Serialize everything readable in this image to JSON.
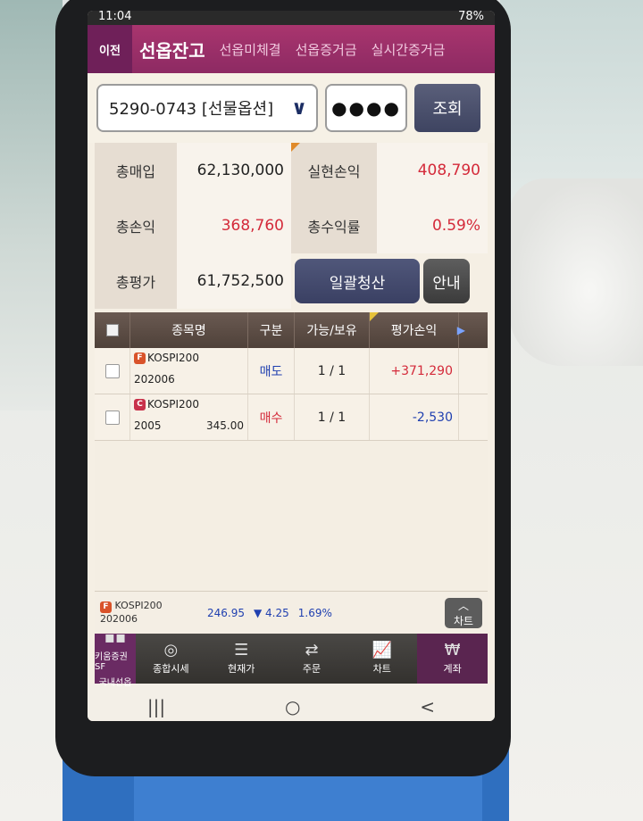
{
  "status_bar": {
    "time": "11:04",
    "battery": "78%"
  },
  "tabs": {
    "prev_label": "이전",
    "items": [
      "선옵잔고",
      "선옵미체결",
      "선옵증거금",
      "실시간증거금"
    ],
    "active": "선옵잔고"
  },
  "account": {
    "number": "5290-0743 [선물옵션]",
    "password_mask": "●●●●",
    "query_label": "조회"
  },
  "summary": {
    "total_buy_label": "총매입",
    "total_buy": "62,130,000",
    "realized_pnl_label": "실현손익",
    "realized_pnl": "408,790",
    "total_pnl_label": "총손익",
    "total_pnl": "368,760",
    "total_return_label": "총수익률",
    "total_return": "0.59%",
    "total_eval_label": "총평가",
    "total_eval": "61,752,500",
    "liquidate_label": "일괄청산",
    "guide_label": "안내"
  },
  "table": {
    "headers": {
      "name": "종목명",
      "type": "구분",
      "qty": "가능/보유",
      "pnl": "평가손익"
    },
    "rows": [
      {
        "badge": "F",
        "product": "KOSPI200",
        "code": "202006",
        "extra": "",
        "type": "매도",
        "qty": "1 / 1",
        "pnl": "+371,290"
      },
      {
        "badge": "C",
        "product": "KOSPI200",
        "code": "2005",
        "extra": "345.00",
        "type": "매수",
        "qty": "1 / 1",
        "pnl": "-2,530"
      }
    ]
  },
  "ticker": {
    "badge": "F",
    "product": "KOSPI200",
    "code": "202006",
    "price": "246.95",
    "change": "▼ 4.25",
    "pct": "1.69%",
    "chart_label": "차트"
  },
  "bottom_nav": {
    "home_brand": "키움증권SF",
    "home_label": "국내선옵",
    "items": [
      "종합시세",
      "현재가",
      "주문",
      "차트",
      "계좌"
    ]
  },
  "android_nav": {
    "recent": "|||",
    "home": "○",
    "back": "<"
  }
}
